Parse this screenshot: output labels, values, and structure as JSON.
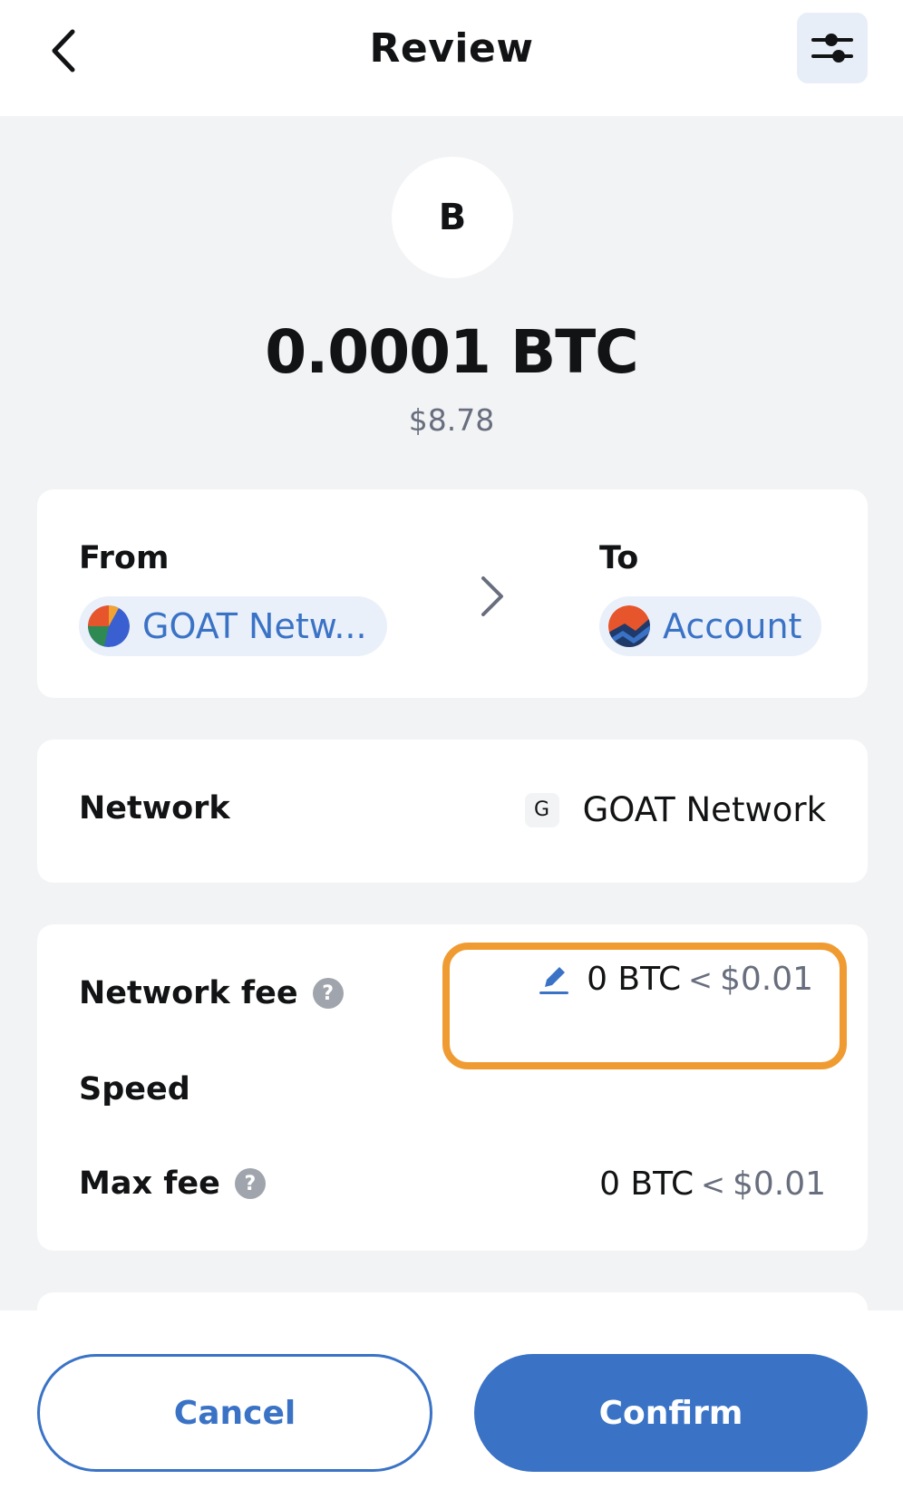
{
  "header": {
    "title": "Review",
    "back_icon": "chevron-left-icon",
    "settings_icon": "sliders-icon"
  },
  "token": {
    "avatar_letter": "B",
    "amount": "0.0001 BTC",
    "fiat": "$8.78"
  },
  "from_to": {
    "from_label": "From",
    "from_value": "GOAT Netw...",
    "to_label": "To",
    "to_value": "Account"
  },
  "network": {
    "label": "Network",
    "badge": "G",
    "value": "GOAT Network"
  },
  "fees": {
    "network_fee_label": "Network fee",
    "help_glyph": "?",
    "network_fee_btc": "0 BTC",
    "network_fee_sep": "<",
    "network_fee_fiat": "$0.01",
    "speed_label": "Speed",
    "max_fee_label": "Max fee",
    "max_fee_btc": "0 BTC",
    "max_fee_sep": "<",
    "max_fee_fiat": "$0.01"
  },
  "footer": {
    "cancel_label": "Cancel",
    "confirm_label": "Confirm"
  },
  "colors": {
    "accent": "#3a73c6",
    "highlight": "#f09b32",
    "background": "#f2f3f5"
  }
}
